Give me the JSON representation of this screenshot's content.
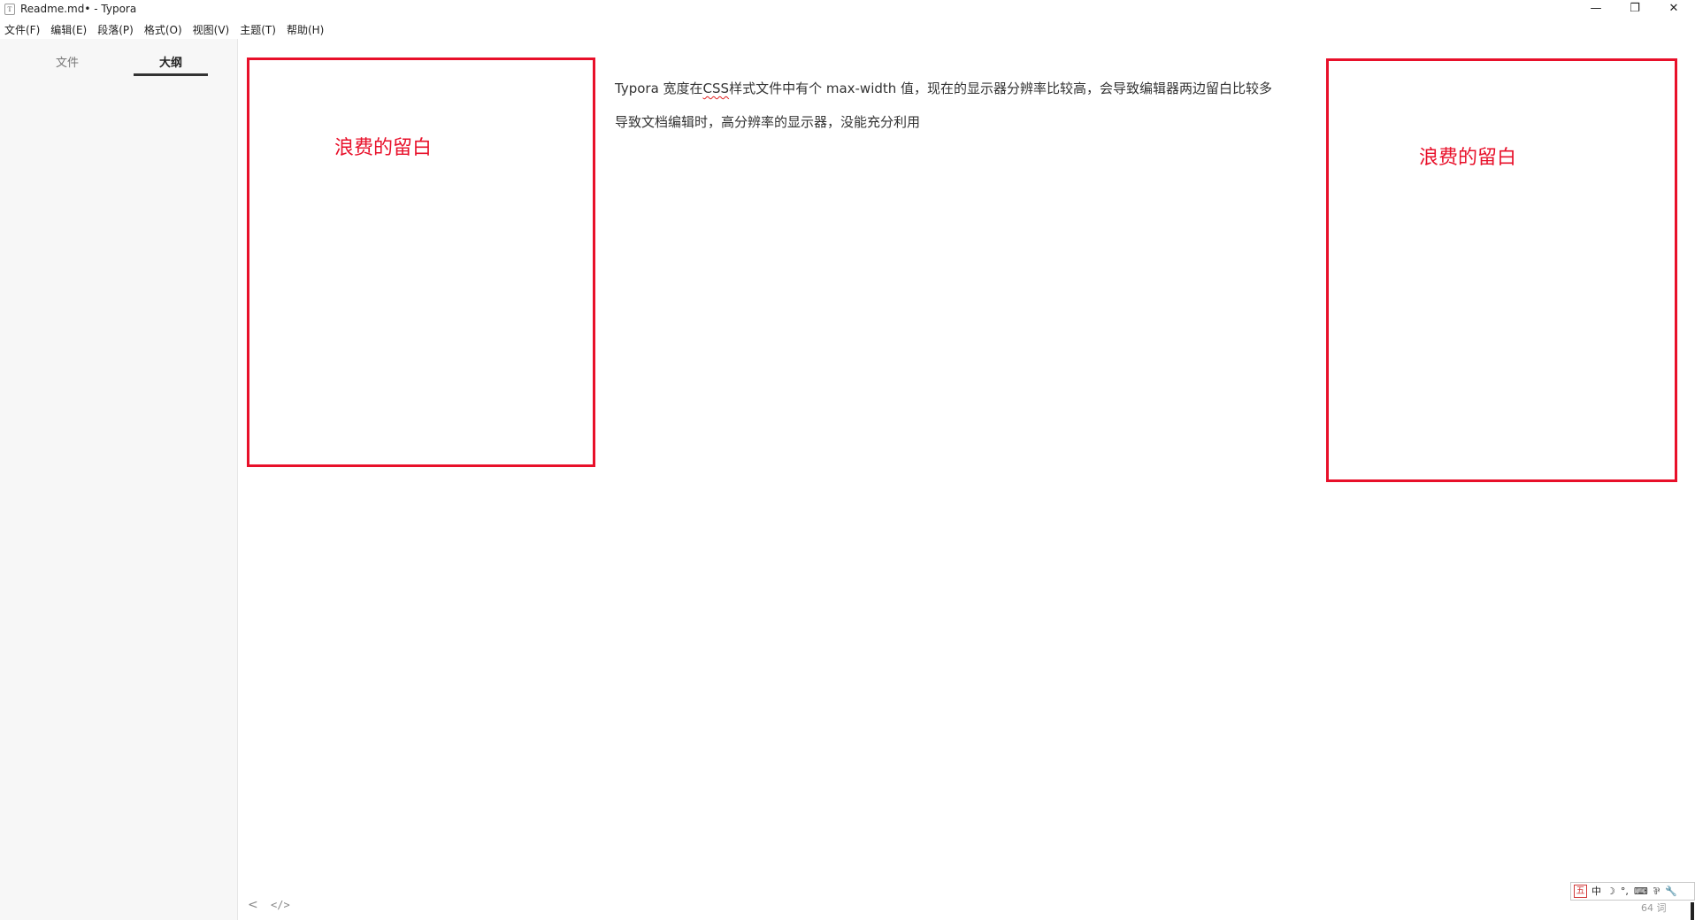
{
  "window": {
    "title": "Readme.md• - Typora",
    "app_icon": "T",
    "controls": {
      "minimize": "—",
      "maximize": "❐",
      "close": "✕"
    }
  },
  "menu": [
    {
      "label": "文件(F)"
    },
    {
      "label": "编辑(E)"
    },
    {
      "label": "段落(P)"
    },
    {
      "label": "格式(O)"
    },
    {
      "label": "视图(V)"
    },
    {
      "label": "主题(T)"
    },
    {
      "label": "帮助(H)"
    }
  ],
  "sidebar": {
    "tabs": [
      {
        "label": "文件",
        "active": false
      },
      {
        "label": "大纲",
        "active": true
      }
    ]
  },
  "document": {
    "line1_before": "Typora 宽度在",
    "line1_css": "CSS",
    "line1_after": "样式文件中有个 max-width 值，现在的显示器分辨率比较高，会导致编辑器两边留白比较多",
    "line2": "导致文档编辑时，高分辨率的显示器，没能充分利用"
  },
  "annotations": {
    "left_label": "浪费的留白",
    "right_label": "浪费的留白",
    "color": "#e8102a"
  },
  "footer": {
    "back_icon": "<",
    "source_icon": "</>",
    "word_count": "64 词"
  },
  "ime_toolbar": {
    "logo": "五",
    "items": [
      "中",
      "☽",
      "°,",
      "⌨",
      "⅌",
      "🔧"
    ]
  }
}
